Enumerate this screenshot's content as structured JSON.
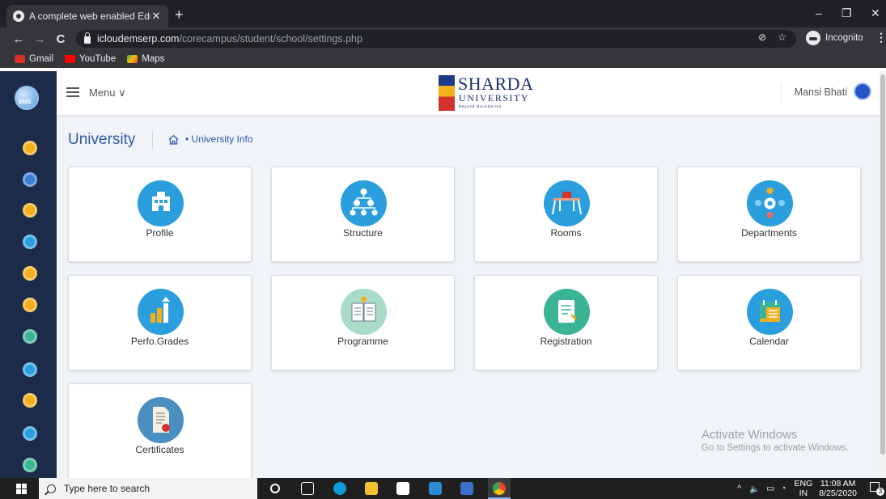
{
  "browser": {
    "tab_title": "A complete web enabled Educati",
    "tab_close": "✕",
    "new_tab": "+",
    "url_host": "icloudemserp.com",
    "url_path": "/corecampus/student/school/settings.php",
    "profile_label": "Incognito",
    "window_controls": [
      "–",
      "❐",
      "✕"
    ],
    "nav": {
      "back": "←",
      "forward": "→",
      "reload": "C"
    },
    "bookmarks": [
      {
        "label": "Gmail",
        "color": "#d93025"
      },
      {
        "label": "YouTube",
        "color": "#ff0000"
      },
      {
        "label": "Maps",
        "color": "#34a853"
      }
    ]
  },
  "header": {
    "menu_label": "Menu ∨",
    "brand_line1": "SHARDA",
    "brand_line2": "UNIVERSITY",
    "brand_tagline": "Beyond Boundaries",
    "user_name": "Mansi Bhati",
    "logo_text": "EMS"
  },
  "page": {
    "title": "University",
    "breadcrumb": "• University Info"
  },
  "cards": [
    {
      "label": "Profile",
      "icon": "building-icon",
      "color": "#2b9fde"
    },
    {
      "label": "Structure",
      "icon": "hierarchy-icon",
      "color": "#2b9fde"
    },
    {
      "label": "Rooms",
      "icon": "classroom-icon",
      "color": "#2b9fde"
    },
    {
      "label": "Departments",
      "icon": "people-gear-icon",
      "color": "#2b9fde"
    },
    {
      "label": "Perfo.Grades",
      "icon": "bar-chart-icon",
      "color": "#2b9fde"
    },
    {
      "label": "Programme",
      "icon": "open-book-icon",
      "color": "#a8dcc8"
    },
    {
      "label": "Registration",
      "icon": "form-icon",
      "color": "#3bb395"
    },
    {
      "label": "Calendar",
      "icon": "calendar-icon",
      "color": "#2b9fde"
    },
    {
      "label": "Certificates",
      "icon": "certificate-icon",
      "color": "#4a8fc0"
    }
  ],
  "sidebar_icons": [
    {
      "name": "student-icon",
      "color": "#f2b01e"
    },
    {
      "name": "school-icon",
      "color": "#3a7bd5"
    },
    {
      "name": "document-icon",
      "color": "#f2b01e"
    },
    {
      "name": "building-icon",
      "color": "#2b9fde"
    },
    {
      "name": "books-icon",
      "color": "#f2b01e"
    },
    {
      "name": "globe-icon",
      "color": "#f2b01e"
    },
    {
      "name": "classroom-icon",
      "color": "#3bb395"
    },
    {
      "name": "chart-icon",
      "color": "#2b9fde"
    },
    {
      "name": "teacher-icon",
      "color": "#f2b01e"
    },
    {
      "name": "chat-icon",
      "color": "#2b9fde"
    },
    {
      "name": "settings-icon",
      "color": "#3bb395"
    }
  ],
  "watermark": {
    "line1": "Activate Windows",
    "line2": "Go to Settings to activate Windows."
  },
  "taskbar": {
    "search_placeholder": "Type here to search",
    "lang_top": "ENG",
    "lang_bottom": "IN",
    "time": "11:08 AM",
    "date": "8/25/2020",
    "notification_count": "3"
  }
}
